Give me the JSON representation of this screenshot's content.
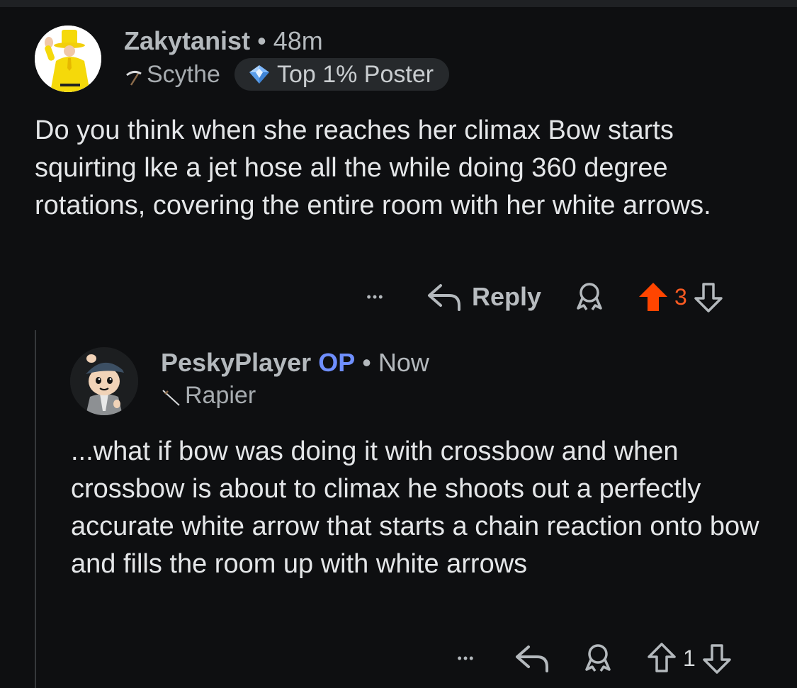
{
  "comments": [
    {
      "username": "Zakytanist",
      "separator": "•",
      "time": "48m",
      "flair": "Scythe",
      "achievement": "Top 1% Poster",
      "body": "Do you think when she reaches her climax Bow starts squirting lke a jet hose all the while doing 360 degree rotations, covering the entire room with her white arrows.",
      "actions": {
        "more": "•••",
        "reply": "Reply",
        "votes": "3"
      }
    },
    {
      "username": "PeskyPlayer",
      "op": "OP",
      "separator": "•",
      "time": "Now",
      "flair": "Rapier",
      "body": "...what if bow was doing it with crossbow and when crossbow is about to climax he shoots out a perfectly accurate white arrow that starts a chain reaction onto bow and fills the room up with white arrows",
      "actions": {
        "more": "•••",
        "votes": "1"
      }
    }
  ],
  "colors": {
    "background": "#0e0f11",
    "upvote_active": "#ff4500",
    "op": "#6f8fff"
  },
  "icons": {
    "reply": "reply-arrow-icon",
    "award": "award-icon",
    "upvote": "upvote-arrow-icon",
    "downvote": "downvote-arrow-icon",
    "more": "more-dots-icon",
    "flair_scythe": "scythe-icon",
    "flair_rapier": "rapier-icon",
    "achievement": "top-poster-badge-icon"
  }
}
